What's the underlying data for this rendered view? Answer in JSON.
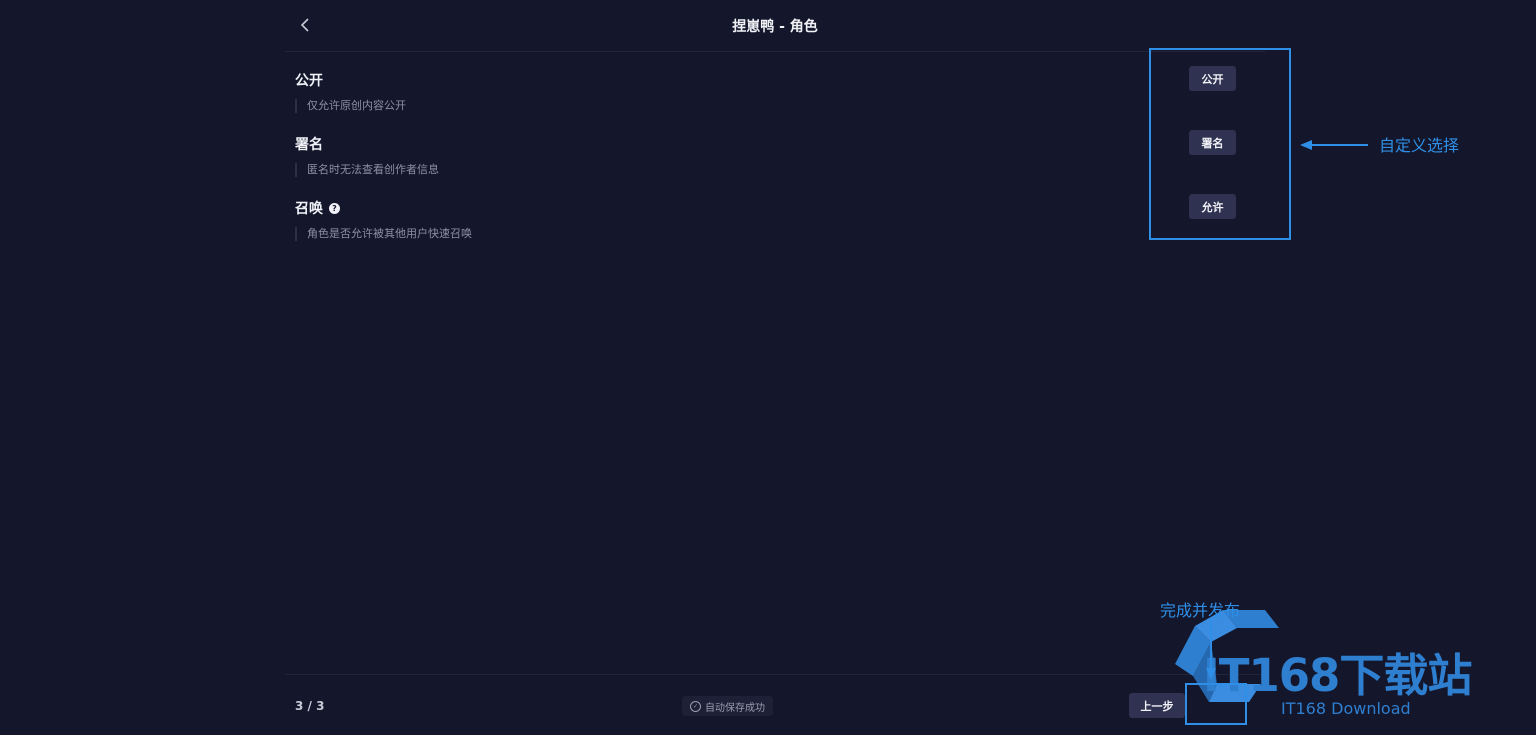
{
  "header": {
    "title": "捏崽鸭 - 角色"
  },
  "settings": [
    {
      "title": "公开",
      "description": "仅允许原创内容公开",
      "option": "公开"
    },
    {
      "title": "署名",
      "description": "匿名时无法查看创作者信息",
      "option": "署名"
    },
    {
      "title": "召唤",
      "description": "角色是否允许被其他用户快速召唤",
      "option": "允许"
    }
  ],
  "annotations": {
    "custom_select": "自定义选择",
    "finish_publish": "完成并发布"
  },
  "footer": {
    "step": "3 / 3",
    "autosave": "自动保存成功",
    "prev_label": "上一步"
  },
  "watermark": {
    "title": "IT168下载站",
    "subtitle": "IT168 Download"
  },
  "colors": {
    "background": "#14162b",
    "button": "#2f3250",
    "annotation": "#2f8fe6"
  }
}
